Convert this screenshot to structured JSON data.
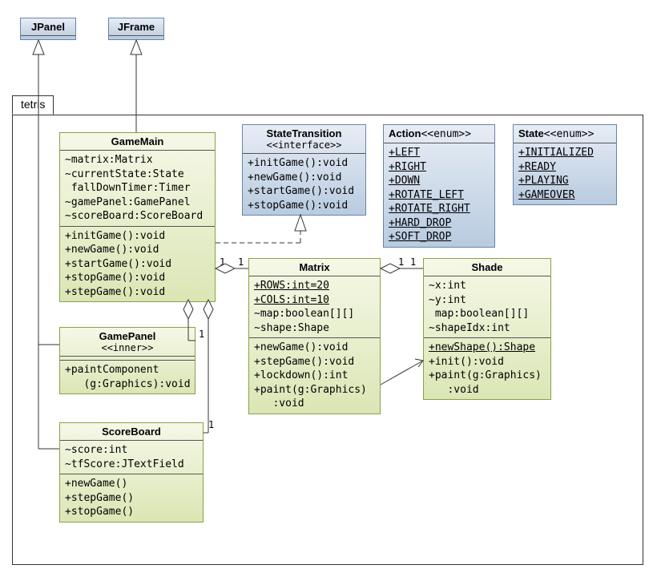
{
  "package": {
    "name": "tetris"
  },
  "external": {
    "jpanel": {
      "name": "JPanel"
    },
    "jframe": {
      "name": "JFrame"
    }
  },
  "classes": {
    "gamemain": {
      "name": "GameMain",
      "attrs": [
        "~matrix:Matrix",
        "~currentState:State",
        " fallDownTimer:Timer",
        "~gamePanel:GamePanel",
        "~scoreBoard:ScoreBoard"
      ],
      "ops": [
        "+initGame():void",
        "+newGame():void",
        "+startGame():void",
        "+stopGame():void",
        "+stepGame():void"
      ]
    },
    "gamepanel": {
      "name": "GamePanel",
      "stereo": "<<inner>>",
      "ops": [
        "+paintComponent",
        "   (g:Graphics):void"
      ]
    },
    "scoreboard": {
      "name": "ScoreBoard",
      "attrs": [
        "~score:int",
        "~tfScore:JTextField"
      ],
      "ops": [
        "+newGame()",
        "+stepGame()",
        "+stopGame()"
      ]
    },
    "statetransition": {
      "name": "StateTransition",
      "stereo": "<<interface>>",
      "ops": [
        "+initGame():void",
        "+newGame():void",
        "+startGame():void",
        "+stopGame():void"
      ]
    },
    "action": {
      "name": "Action",
      "stereo": "<<enum>>",
      "vals": [
        "+LEFT",
        "+RIGHT",
        "+DOWN",
        "+ROTATE_LEFT",
        "+ROTATE_RIGHT",
        "+HARD_DROP",
        "+SOFT_DROP"
      ]
    },
    "state": {
      "name": "State",
      "stereo": "<<enum>>",
      "vals": [
        "+INITIALIZED",
        "+READY",
        "+PLAYING",
        "+GAMEOVER"
      ]
    },
    "matrix": {
      "name": "Matrix",
      "attrs": [
        "+ROWS:int=20",
        "+COLS:int=10",
        "~map:boolean[][]",
        "~shape:Shape"
      ],
      "attrs_underline": [
        true,
        true,
        false,
        false
      ],
      "ops": [
        "+newGame():void",
        "+stepGame():void",
        "+lockdown():int",
        "+paint(g:Graphics)",
        "   :void"
      ]
    },
    "shade": {
      "name": "Shade",
      "attrs": [
        "~x:int",
        "~y:int",
        " map:boolean[][]",
        "~shapeIdx:int"
      ],
      "ops": [
        "+newShape():Shape",
        "+init():void",
        "+paint(g:Graphics)",
        "   :void"
      ],
      "ops_underline": [
        true,
        false,
        false,
        false
      ]
    }
  },
  "mult": {
    "gm_matrix_l": "1",
    "gm_matrix_r": "1",
    "gm_panel": "1",
    "gm_score": "1",
    "matrix_shade_l": "1",
    "matrix_shade_r": "1"
  }
}
